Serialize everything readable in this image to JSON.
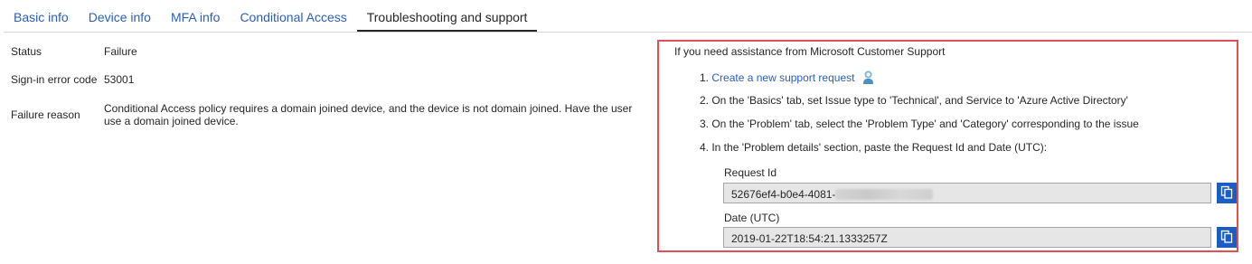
{
  "tabs": [
    {
      "label": "Basic info"
    },
    {
      "label": "Device info"
    },
    {
      "label": "MFA info"
    },
    {
      "label": "Conditional Access"
    },
    {
      "label": "Troubleshooting and support",
      "active": true
    }
  ],
  "details": {
    "status_label": "Status",
    "status_value": "Failure",
    "error_code_label": "Sign-in error code",
    "error_code_value": "53001",
    "failure_reason_label": "Failure reason",
    "failure_reason_value": "Conditional Access policy requires a domain joined device, and the device is not domain joined. Have the user use a domain joined device."
  },
  "support": {
    "title": "If you need assistance from Microsoft Customer Support",
    "step1_prefix": "1.",
    "step1_link": "Create a new support request",
    "step2": "2. On the 'Basics' tab, set Issue type to 'Technical', and Service to 'Azure Active Directory'",
    "step3": "3. On the 'Problem' tab, select the 'Problem Type' and 'Category' corresponding to the issue",
    "step4": "4. In the 'Problem details' section, paste the Request Id and Date (UTC):",
    "request_id_label": "Request Id",
    "request_id_value": "52676ef4-b0e4-4081-",
    "date_label": "Date (UTC)",
    "date_value": "2019-01-22T18:54:21.1333257Z"
  },
  "colors": {
    "link": "#2b5fb6",
    "highlight_border": "#e05055",
    "copy_button": "#1c5dc4"
  },
  "icons": [
    "support-person-icon",
    "copy-icon"
  ]
}
